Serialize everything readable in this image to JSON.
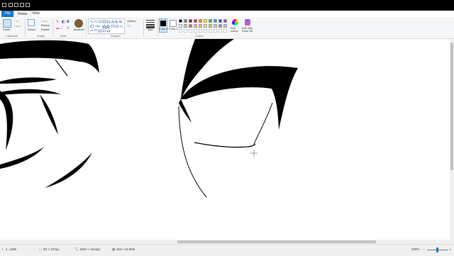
{
  "tabs": {
    "file": "File",
    "home": "Home",
    "view": "View"
  },
  "clipboard": {
    "paste": "Paste",
    "cut": "Cut",
    "copy": "Copy",
    "label": "Clipboard"
  },
  "image": {
    "select": "Select",
    "crop": "Crop",
    "resize": "Resize",
    "rotate": "Rotate",
    "label": "Image"
  },
  "tools": {
    "label": "Tools"
  },
  "brushes": {
    "label": "Brushes"
  },
  "shapes": {
    "outline": "Outline",
    "fill": "Fill",
    "label": "Shapes"
  },
  "size": {
    "label": "Size"
  },
  "colors": {
    "color1": "Color 1",
    "color2": "Color 2",
    "edit": "Edit colors",
    "edit_paint3d": "Edit with Paint 3D",
    "label": "Colors",
    "palette_row1": [
      "#000000",
      "#7f7f7f",
      "#880015",
      "#ed1c24",
      "#ff7f27",
      "#fff200",
      "#22b14c",
      "#00a2e8",
      "#3f48cc",
      "#a349a4"
    ],
    "palette_row2": [
      "#ffffff",
      "#c3c3c3",
      "#b97a57",
      "#ffaec9",
      "#ffc90e",
      "#efe4b0",
      "#b5e61d",
      "#99d9ea",
      "#7092be",
      "#c8bfe7"
    ]
  },
  "status": {
    "cursor_pos": "1,  1296",
    "selection_size": "93 × 107px",
    "image_size": "1920 × 1114px",
    "file_size": "Size: 14.5KB",
    "zoom": "200%"
  }
}
